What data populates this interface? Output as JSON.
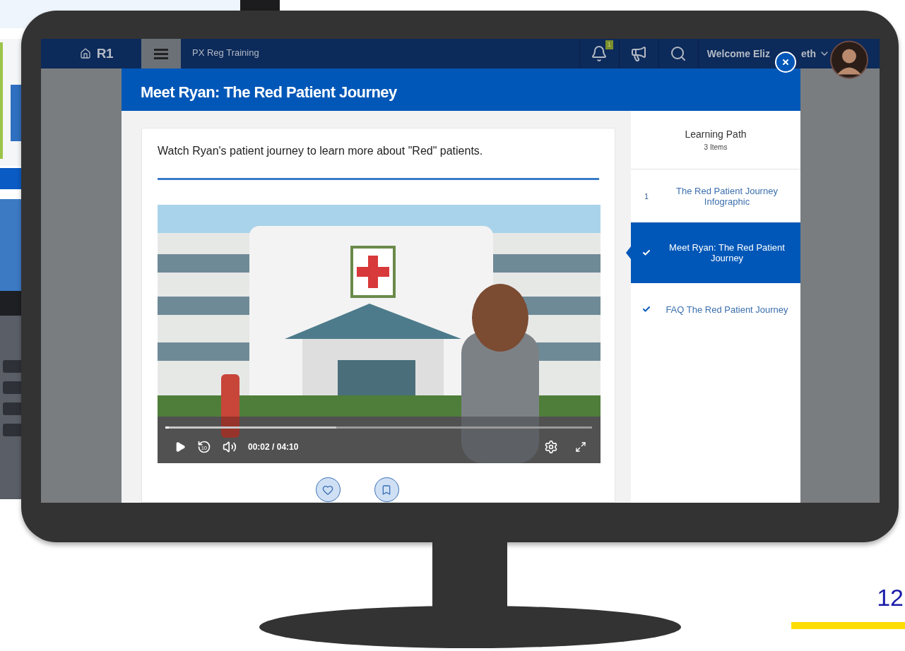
{
  "navbar": {
    "brand": "R1",
    "title": "PX Reg Training",
    "notification_count": "1",
    "welcome": "Welcome Eliz",
    "welcome_end": "eth"
  },
  "modal": {
    "title": "Meet Ryan: The Red Patient Journey",
    "instruction": "Watch Ryan's patient journey to learn more about \"Red\" patients.",
    "video": {
      "kind": "picture",
      "level": 0.008,
      "time": "00:02",
      "separator": "/",
      "duration": "04:10",
      "skip_seconds": "10"
    },
    "learning_path": {
      "title": "Learning Path",
      "count": "3 Items",
      "items": [
        {
          "number": "1",
          "completed": false,
          "selected": false,
          "title": "The Red Patient Journey Infographic"
        },
        {
          "completed": true,
          "selected": true,
          "title": "Meet Ryan: The Red Patient Journey"
        },
        {
          "completed": true,
          "selected": false,
          "title": "FAQ The Red Patient Journey"
        }
      ]
    }
  },
  "slide": {
    "page_number": "12"
  }
}
